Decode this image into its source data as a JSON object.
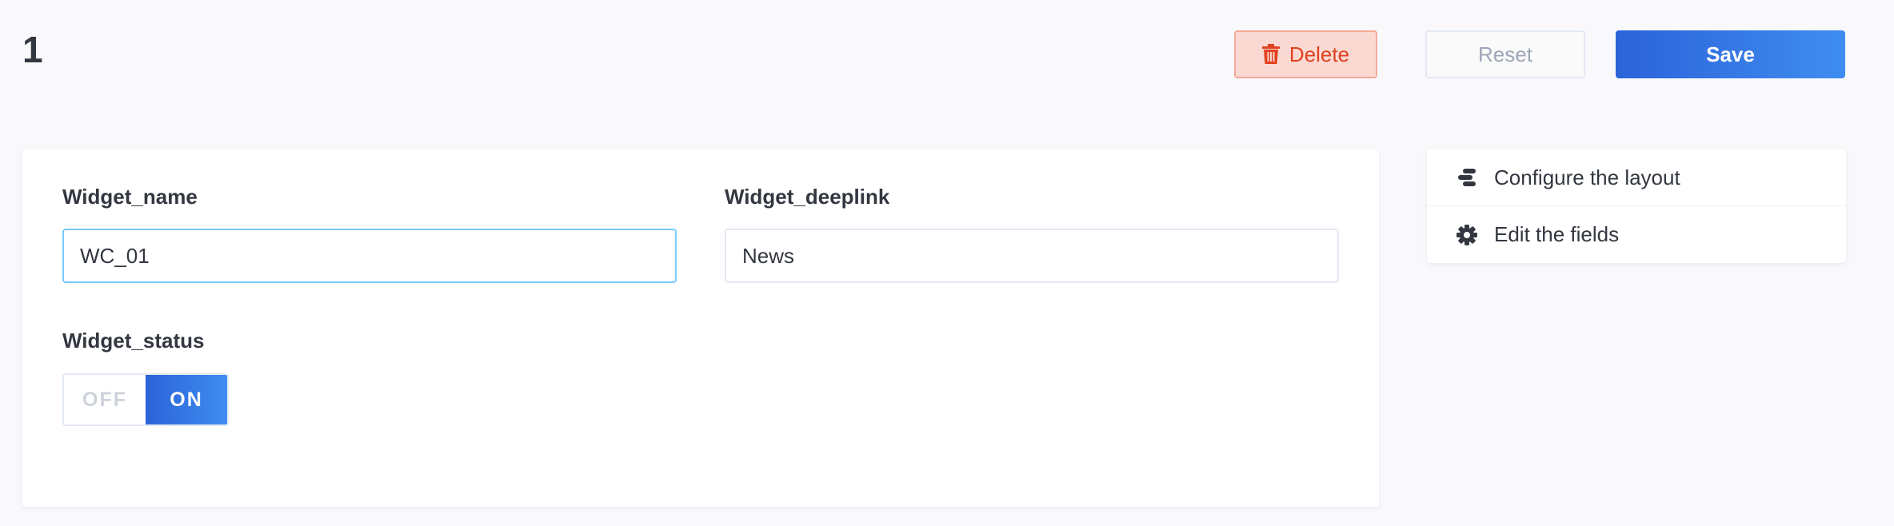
{
  "header": {
    "title": "1",
    "delete_label": "Delete",
    "reset_label": "Reset",
    "save_label": "Save"
  },
  "form": {
    "widget_name": {
      "label": "Widget_name",
      "value": "WC_01"
    },
    "widget_deeplink": {
      "label": "Widget_deeplink",
      "value": "News"
    },
    "widget_status": {
      "label": "Widget_status",
      "off_label": "OFF",
      "on_label": "ON",
      "selected": "ON"
    }
  },
  "side_menu": {
    "items": [
      {
        "label": "Configure the layout",
        "icon": "layout-icon"
      },
      {
        "label": "Edit the fields",
        "icon": "gear-icon"
      }
    ]
  },
  "colors": {
    "primary": "#2b63d9",
    "danger": "#e0411f",
    "focus_border": "#78caff"
  }
}
